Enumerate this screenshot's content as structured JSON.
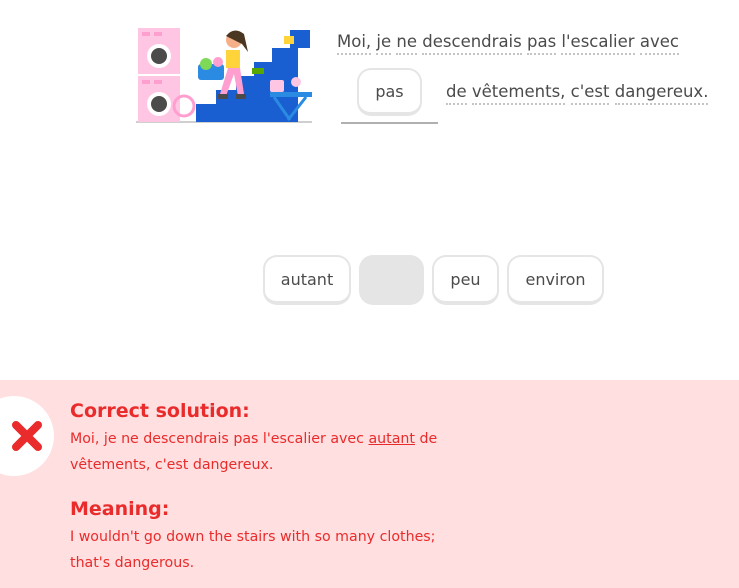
{
  "prompt": {
    "line1_words": [
      "Moi,",
      "je",
      "ne",
      "descendrais",
      "pas",
      "l'escalier",
      "avec"
    ],
    "blank_answer": "pas",
    "line2_words": [
      "de",
      "vêtements,",
      "c'est",
      "dangereux."
    ]
  },
  "word_bank": {
    "chip1": "autant",
    "chip3": "peu",
    "chip4": "environ"
  },
  "feedback": {
    "solution_heading": "Correct solution:",
    "solution_before": "Moi, je ne descendrais pas l'escalier avec ",
    "solution_highlight": "autant",
    "solution_after_1": " de",
    "solution_line2": "vêtements, c'est dangereux.",
    "meaning_heading": "Meaning:",
    "meaning_line1": "I wouldn't go down the stairs with so many clothes;",
    "meaning_line2": "that's dangerous.",
    "status_icon": "close-x-icon"
  },
  "colors": {
    "error_red": "#ea2b2b",
    "feedback_bg": "#ffdfe0",
    "chip_border": "#e5e5e5",
    "text": "#4b4b4b"
  }
}
